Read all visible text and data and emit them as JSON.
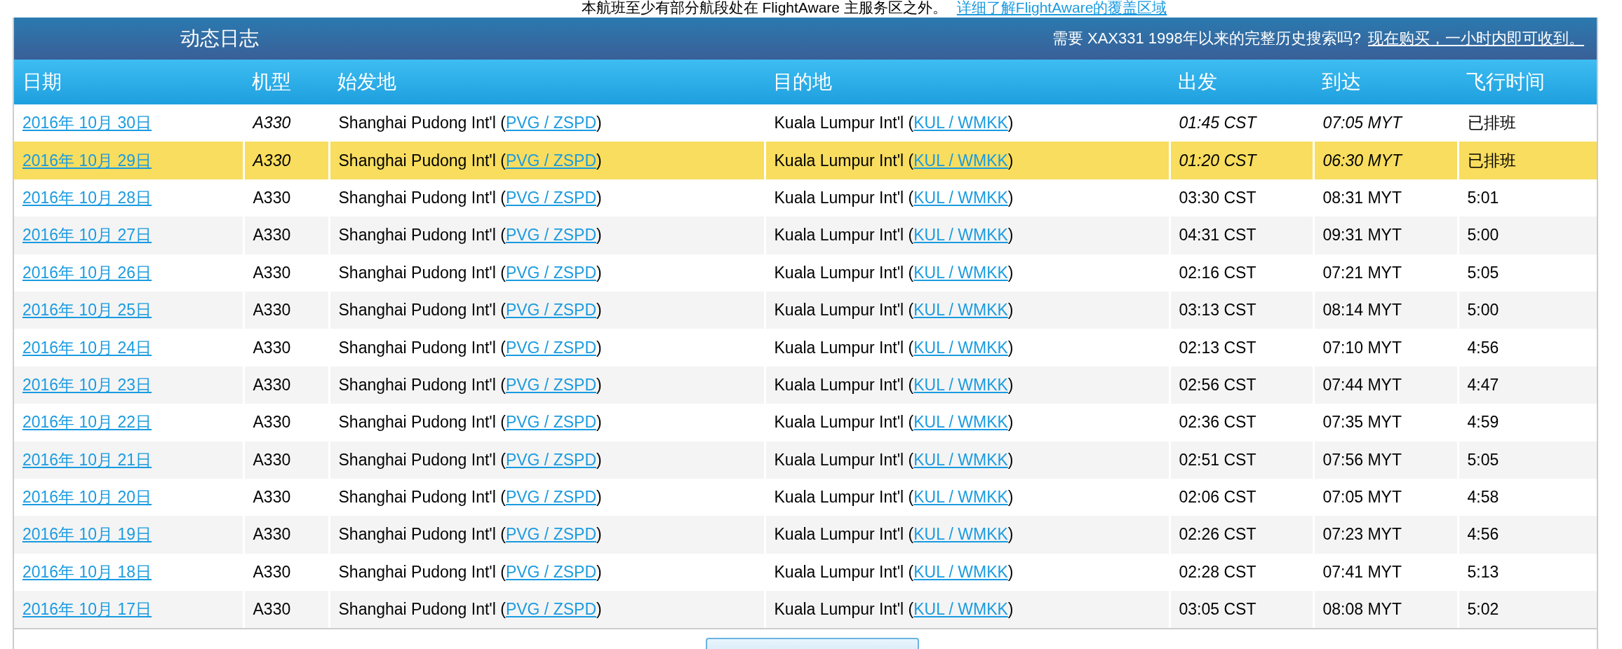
{
  "notice": {
    "text": "本航班至少有部分航段处在 FlightAware 主服务区之外。",
    "link": "详细了解FlightAware的覆盖区域"
  },
  "panel": {
    "title": "动态日志",
    "promo_text": "需要 XAX331 1998年以来的完整历史搜索吗?",
    "promo_link": "现在购买，一小时内即可收到。"
  },
  "table": {
    "columns": [
      "日期",
      "机型",
      "始发地",
      "目的地",
      "出发",
      "到达",
      "飞行时间"
    ],
    "rows": [
      {
        "date": "2016年 10月 30日",
        "aircraft": "A330",
        "origin": "Shanghai Pudong Int'l (",
        "origin_code": "PVG / ZSPD",
        "origin_close": ")",
        "destination": "Kuala Lumpur Int'l (",
        "destination_code": "KUL / WMKK",
        "destination_close": ")",
        "departure": "01:45 CST",
        "arrival": "07:05 MYT",
        "duration": "已排班",
        "kind": "scheduled",
        "selected": false
      },
      {
        "date": "2016年 10月 29日",
        "aircraft": "A330",
        "origin": "Shanghai Pudong Int'l (",
        "origin_code": "PVG / ZSPD",
        "origin_close": ")",
        "destination": "Kuala Lumpur Int'l (",
        "destination_code": "KUL / WMKK",
        "destination_close": ")",
        "departure": "01:20 CST",
        "arrival": "06:30 MYT",
        "duration": "已排班",
        "kind": "scheduled",
        "selected": true
      },
      {
        "date": "2016年 10月 28日",
        "aircraft": "A330",
        "origin": "Shanghai Pudong Int'l (",
        "origin_code": "PVG / ZSPD",
        "origin_close": ")",
        "destination": "Kuala Lumpur Int'l (",
        "destination_code": "KUL / WMKK",
        "destination_close": ")",
        "departure": "03:30 CST",
        "arrival": "08:31 MYT",
        "duration": "5:01",
        "kind": "completed",
        "selected": false
      },
      {
        "date": "2016年 10月 27日",
        "aircraft": "A330",
        "origin": "Shanghai Pudong Int'l (",
        "origin_code": "PVG / ZSPD",
        "origin_close": ")",
        "destination": "Kuala Lumpur Int'l (",
        "destination_code": "KUL / WMKK",
        "destination_close": ")",
        "departure": "04:31 CST",
        "arrival": "09:31 MYT",
        "duration": "5:00",
        "kind": "completed",
        "selected": false
      },
      {
        "date": "2016年 10月 26日",
        "aircraft": "A330",
        "origin": "Shanghai Pudong Int'l (",
        "origin_code": "PVG / ZSPD",
        "origin_close": ")",
        "destination": "Kuala Lumpur Int'l (",
        "destination_code": "KUL / WMKK",
        "destination_close": ")",
        "departure": "02:16 CST",
        "arrival": "07:21 MYT",
        "duration": "5:05",
        "kind": "completed",
        "selected": false
      },
      {
        "date": "2016年 10月 25日",
        "aircraft": "A330",
        "origin": "Shanghai Pudong Int'l (",
        "origin_code": "PVG / ZSPD",
        "origin_close": ")",
        "destination": "Kuala Lumpur Int'l (",
        "destination_code": "KUL / WMKK",
        "destination_close": ")",
        "departure": "03:13 CST",
        "arrival": "08:14 MYT",
        "duration": "5:00",
        "kind": "completed",
        "selected": false
      },
      {
        "date": "2016年 10月 24日",
        "aircraft": "A330",
        "origin": "Shanghai Pudong Int'l (",
        "origin_code": "PVG / ZSPD",
        "origin_close": ")",
        "destination": "Kuala Lumpur Int'l (",
        "destination_code": "KUL / WMKK",
        "destination_close": ")",
        "departure": "02:13 CST",
        "arrival": "07:10 MYT",
        "duration": "4:56",
        "kind": "completed",
        "selected": false
      },
      {
        "date": "2016年 10月 23日",
        "aircraft": "A330",
        "origin": "Shanghai Pudong Int'l (",
        "origin_code": "PVG / ZSPD",
        "origin_close": ")",
        "destination": "Kuala Lumpur Int'l (",
        "destination_code": "KUL / WMKK",
        "destination_close": ")",
        "departure": "02:56 CST",
        "arrival": "07:44 MYT",
        "duration": "4:47",
        "kind": "completed",
        "selected": false
      },
      {
        "date": "2016年 10月 22日",
        "aircraft": "A330",
        "origin": "Shanghai Pudong Int'l (",
        "origin_code": "PVG / ZSPD",
        "origin_close": ")",
        "destination": "Kuala Lumpur Int'l (",
        "destination_code": "KUL / WMKK",
        "destination_close": ")",
        "departure": "02:36 CST",
        "arrival": "07:35 MYT",
        "duration": "4:59",
        "kind": "completed",
        "selected": false
      },
      {
        "date": "2016年 10月 21日",
        "aircraft": "A330",
        "origin": "Shanghai Pudong Int'l (",
        "origin_code": "PVG / ZSPD",
        "origin_close": ")",
        "destination": "Kuala Lumpur Int'l (",
        "destination_code": "KUL / WMKK",
        "destination_close": ")",
        "departure": "02:51 CST",
        "arrival": "07:56 MYT",
        "duration": "5:05",
        "kind": "completed",
        "selected": false
      },
      {
        "date": "2016年 10月 20日",
        "aircraft": "A330",
        "origin": "Shanghai Pudong Int'l (",
        "origin_code": "PVG / ZSPD",
        "origin_close": ")",
        "destination": "Kuala Lumpur Int'l (",
        "destination_code": "KUL / WMKK",
        "destination_close": ")",
        "departure": "02:06 CST",
        "arrival": "07:05 MYT",
        "duration": "4:58",
        "kind": "completed",
        "selected": false
      },
      {
        "date": "2016年 10月 19日",
        "aircraft": "A330",
        "origin": "Shanghai Pudong Int'l (",
        "origin_code": "PVG / ZSPD",
        "origin_close": ")",
        "destination": "Kuala Lumpur Int'l (",
        "destination_code": "KUL / WMKK",
        "destination_close": ")",
        "departure": "02:26 CST",
        "arrival": "07:23 MYT",
        "duration": "4:56",
        "kind": "completed",
        "selected": false
      },
      {
        "date": "2016年 10月 18日",
        "aircraft": "A330",
        "origin": "Shanghai Pudong Int'l (",
        "origin_code": "PVG / ZSPD",
        "origin_close": ")",
        "destination": "Kuala Lumpur Int'l (",
        "destination_code": "KUL / WMKK",
        "destination_close": ")",
        "departure": "02:28 CST",
        "arrival": "07:41 MYT",
        "duration": "5:13",
        "kind": "completed",
        "selected": false
      },
      {
        "date": "2016年 10月 17日",
        "aircraft": "A330",
        "origin": "Shanghai Pudong Int'l (",
        "origin_code": "PVG / ZSPD",
        "origin_close": ")",
        "destination": "Kuala Lumpur Int'l (",
        "destination_code": "KUL / WMKK",
        "destination_close": ")",
        "departure": "03:05 CST",
        "arrival": "08:08 MYT",
        "duration": "5:02",
        "kind": "completed",
        "selected": false
      }
    ]
  }
}
